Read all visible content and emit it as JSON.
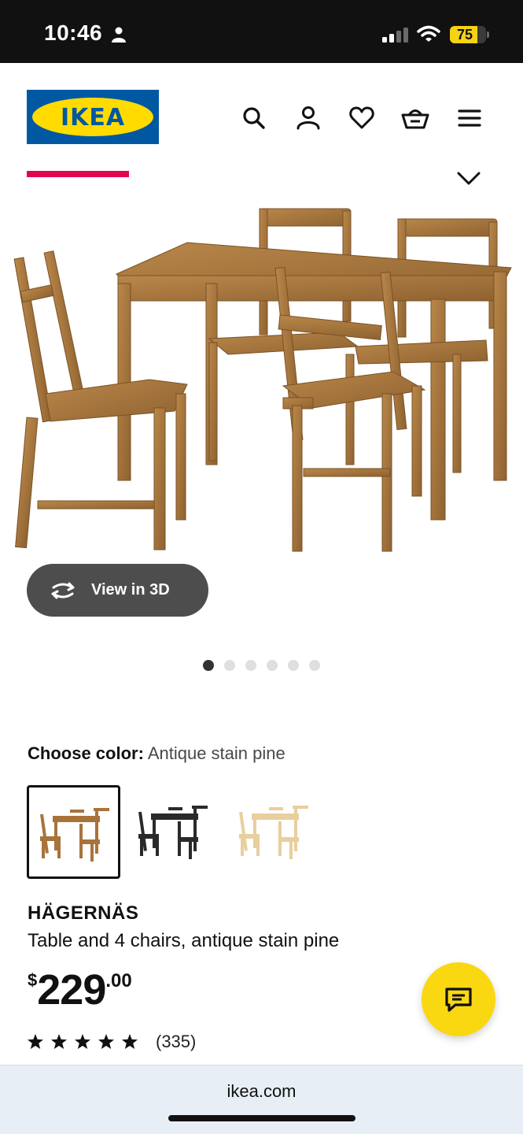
{
  "status_bar": {
    "time": "10:46",
    "battery": "75",
    "battery_level": 0.75
  },
  "header": {
    "logo_text": "IKEA",
    "icons": [
      "search-icon",
      "account-icon",
      "heart-icon",
      "cart-icon",
      "menu-icon"
    ]
  },
  "gallery": {
    "view_3d_label": "View in 3D",
    "image_count": 6,
    "active_index": 0
  },
  "color_picker": {
    "label": "Choose color:",
    "selected_value": "Antique stain pine",
    "swatches": [
      "antique-stain-pine",
      "black",
      "natural-pine"
    ]
  },
  "product": {
    "name": "HÄGERNÄS",
    "description": "Table and 4 chairs, antique stain pine",
    "price_currency": "$",
    "price_integer": "229",
    "price_decimal": ".00",
    "rating_stars": 5,
    "rating_count": "(335)"
  },
  "browser": {
    "url": "ikea.com"
  },
  "colors": {
    "ikea_blue": "#0058a3",
    "ikea_yellow": "#ffdb00",
    "accent_red": "#e00751"
  }
}
